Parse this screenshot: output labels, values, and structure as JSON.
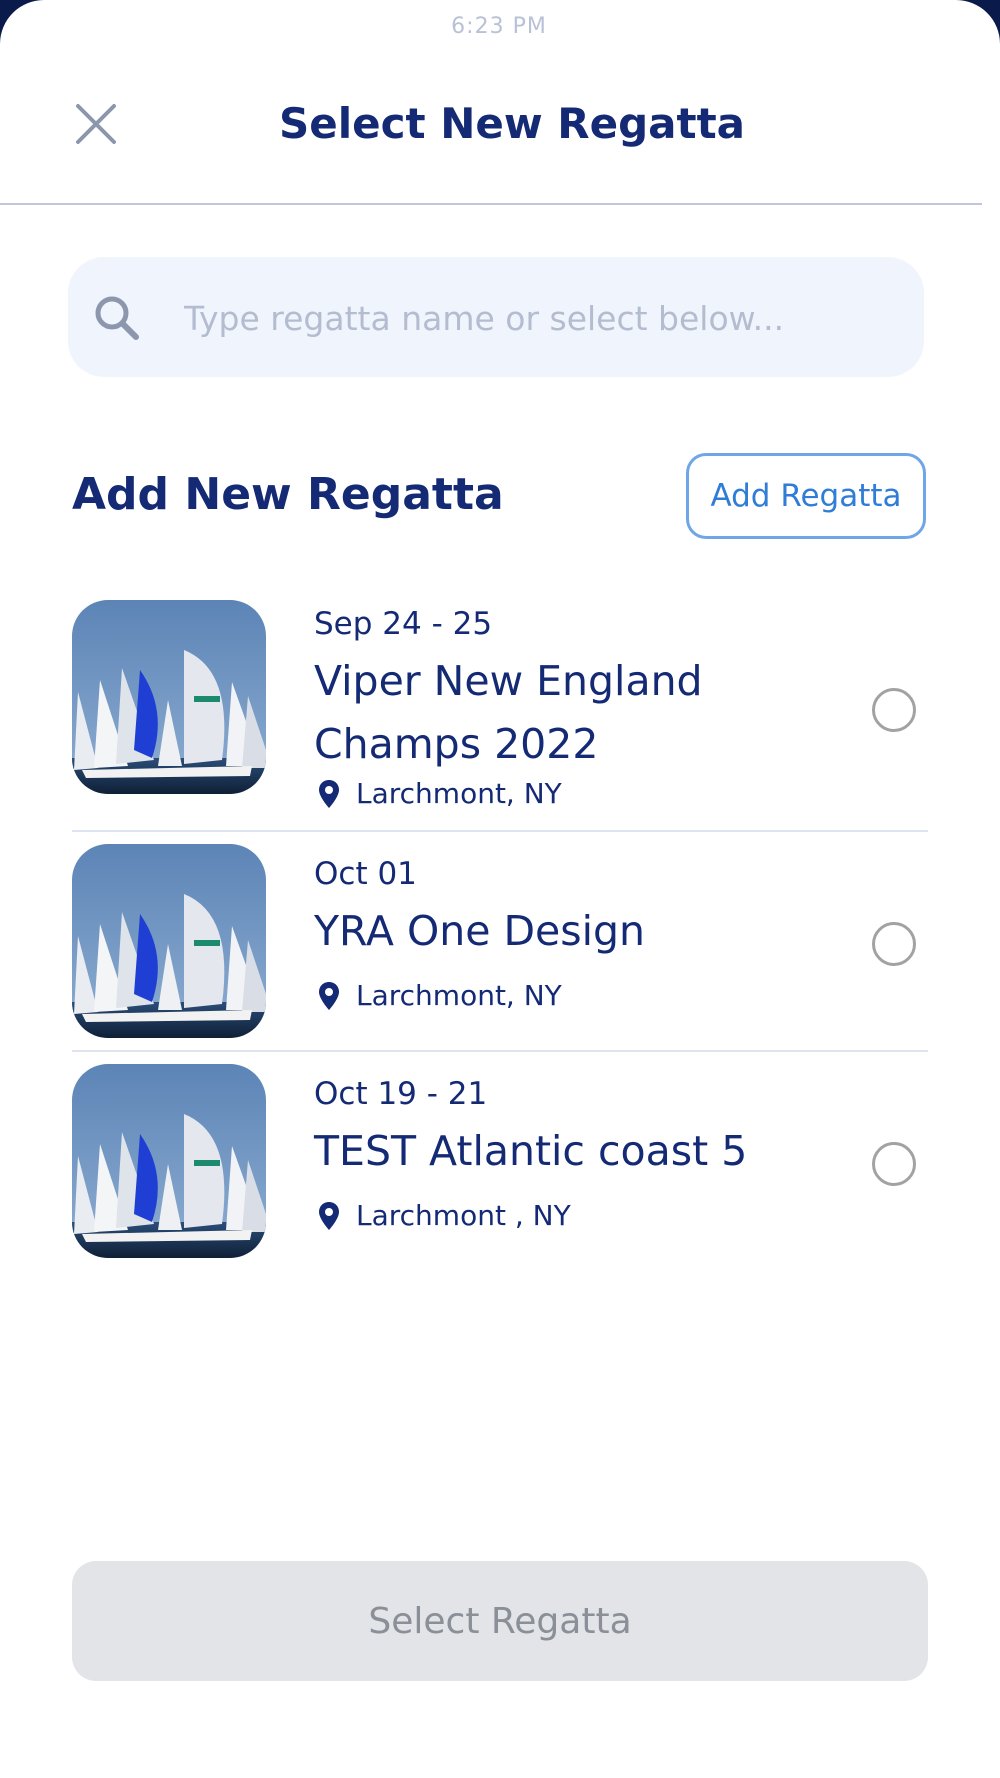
{
  "status_bar": {
    "time": "6:23 PM"
  },
  "header": {
    "title": "Select New Regatta",
    "close_icon": "close-icon"
  },
  "search": {
    "placeholder": "Type regatta name or select below...",
    "value": ""
  },
  "add_section": {
    "title": "Add New Regatta",
    "button_label": "Add Regatta"
  },
  "regattas": [
    {
      "date": "Sep 24 - 25",
      "name": "Viper New England Champs 2022",
      "location": "Larchmont, NY",
      "selected": false
    },
    {
      "date": "Oct 01",
      "name": "YRA One Design",
      "location": "Larchmont, NY",
      "selected": false
    },
    {
      "date": "Oct 19 - 21",
      "name": "TEST Atlantic coast 5",
      "location": "Larchmont , NY",
      "selected": false
    }
  ],
  "footer": {
    "select_label": "Select Regatta"
  },
  "colors": {
    "primary": "#142a75",
    "accent": "#2f7dd6",
    "disabled_bg": "#e2e4e8",
    "disabled_text": "#8a8f98"
  }
}
